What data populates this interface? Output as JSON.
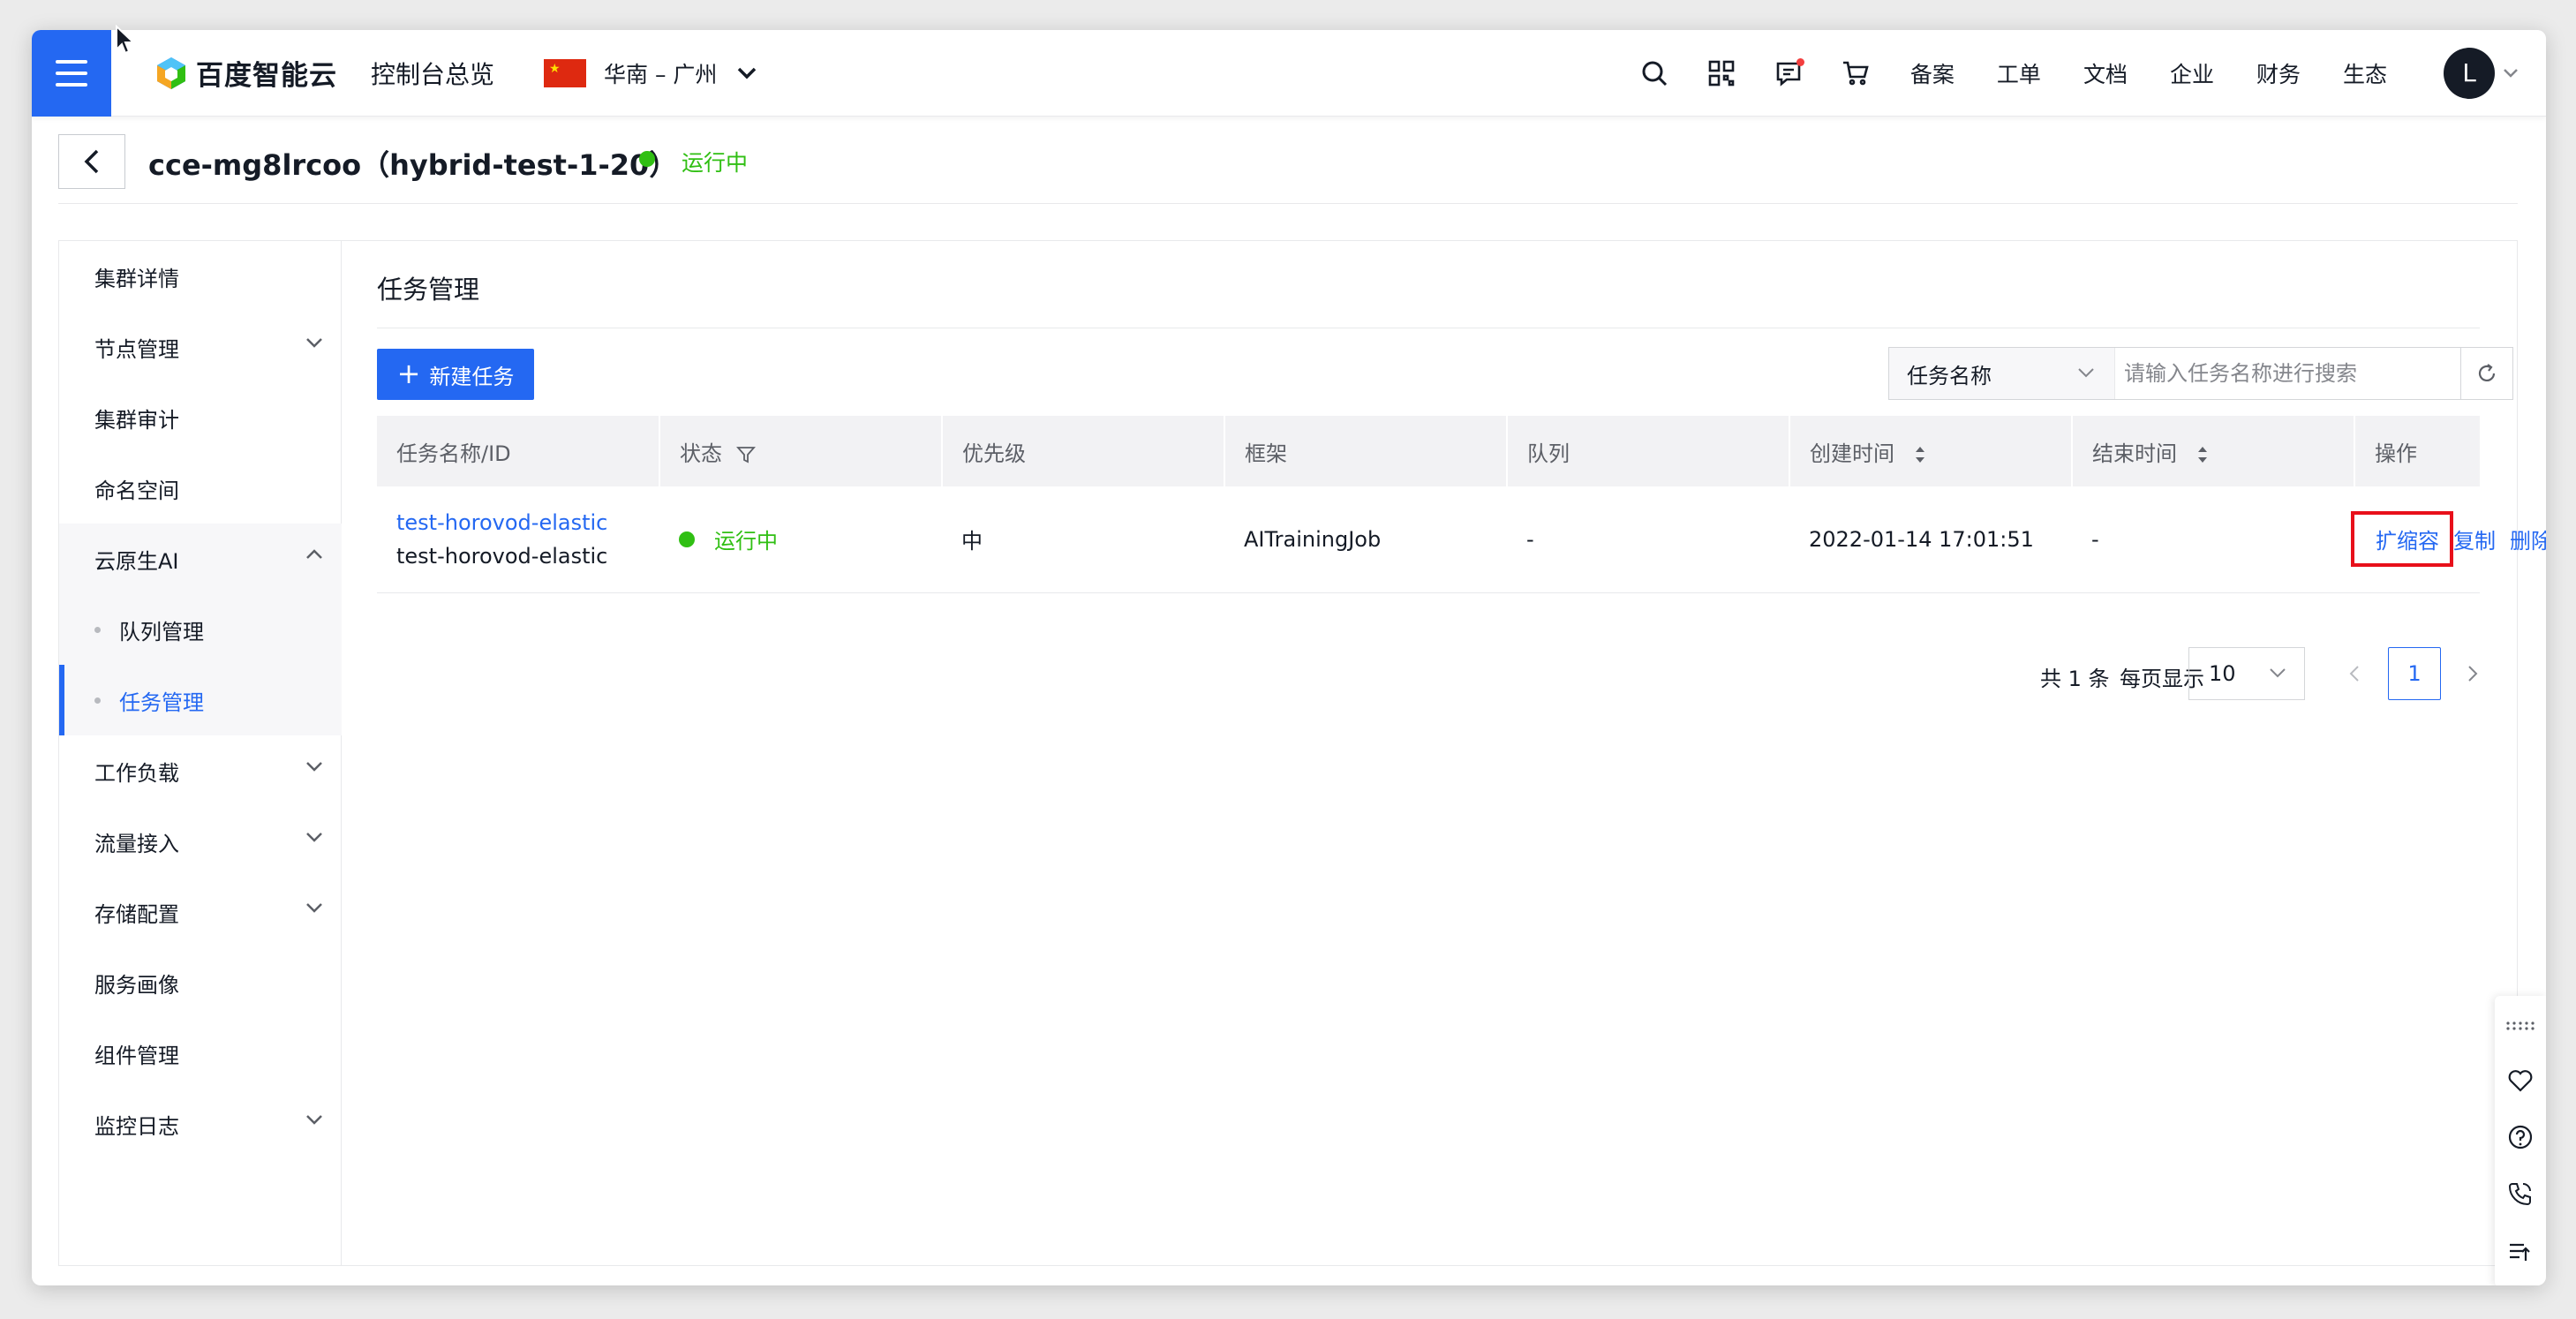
{
  "topbar": {
    "logo_text": "百度智能云",
    "console_home": "控制台总览",
    "region": "华南 – 广州",
    "links": [
      "备案",
      "工单",
      "文档",
      "企业",
      "财务",
      "生态"
    ],
    "avatar_letter": "L"
  },
  "header": {
    "cluster_title": "cce-mg8lrcoo（hybrid-test-1-20）",
    "status": "运行中"
  },
  "sidebar": {
    "items": [
      {
        "label": "集群详情"
      },
      {
        "label": "节点管理"
      },
      {
        "label": "集群审计"
      },
      {
        "label": "命名空间"
      },
      {
        "label": "云原生AI"
      },
      {
        "label": "队列管理"
      },
      {
        "label": "任务管理"
      },
      {
        "label": "工作负载"
      },
      {
        "label": "流量接入"
      },
      {
        "label": "存储配置"
      },
      {
        "label": "服务画像"
      },
      {
        "label": "组件管理"
      },
      {
        "label": "监控日志"
      }
    ]
  },
  "main": {
    "title": "任务管理",
    "new_button": "新建任务",
    "search_field": "任务名称",
    "search_placeholder": "请输入任务名称进行搜索",
    "columns": [
      "任务名称/ID",
      "状态",
      "优先级",
      "框架",
      "队列",
      "创建时间",
      "结束时间",
      "操作"
    ],
    "rows": [
      {
        "name": "test-horovod-elastic",
        "id": "test-horovod-elastic",
        "status": "运行中",
        "priority": "中",
        "framework": "AITrainingJob",
        "queue": "-",
        "created": "2022-01-14 17:01:51",
        "ended": "-",
        "actions": [
          "扩缩容",
          "复制",
          "删除"
        ]
      }
    ],
    "pager": {
      "total": "共 1 条",
      "per_page_label": "每页显示",
      "page_size": "10",
      "current_page": "1"
    }
  },
  "colors": {
    "primary": "#2468f2",
    "success": "#30bf13",
    "highlight": "#e8101a"
  }
}
